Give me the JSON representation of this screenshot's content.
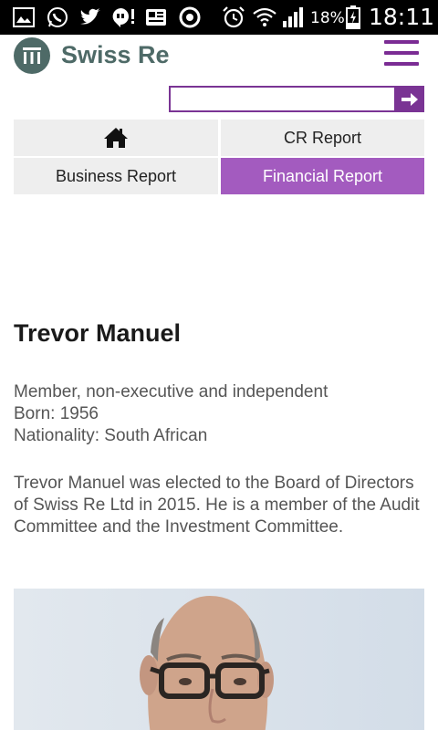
{
  "status_bar": {
    "battery_percent": "18%",
    "time": "18:11",
    "icons": [
      "gallery-icon",
      "whatsapp-icon",
      "twitter-icon",
      "hangouts-icon",
      "news-icon",
      "chrome-icon",
      "alarm-icon",
      "wifi-icon",
      "signal-icon",
      "battery-icon"
    ]
  },
  "header": {
    "brand": "Swiss Re"
  },
  "search": {
    "placeholder": "",
    "value": ""
  },
  "nav": {
    "cr_report": "CR Report",
    "business_report": "Business Report",
    "financial_report": "Financial Report",
    "active": "Financial Report",
    "active_color": "#a35bbf"
  },
  "profile": {
    "name": "Trevor Manuel",
    "role": "Member, non-executive and independent",
    "born": "Born: 1956",
    "nationality": "Nationality: South African",
    "bio": "Trevor Manuel was elected to the Board of Directors of Swiss Re Ltd in 2015. He is a member of the Audit Committee and the Investment Committee."
  },
  "colors": {
    "brand_purple": "#7a3494",
    "brand_green": "#4e6a67"
  }
}
